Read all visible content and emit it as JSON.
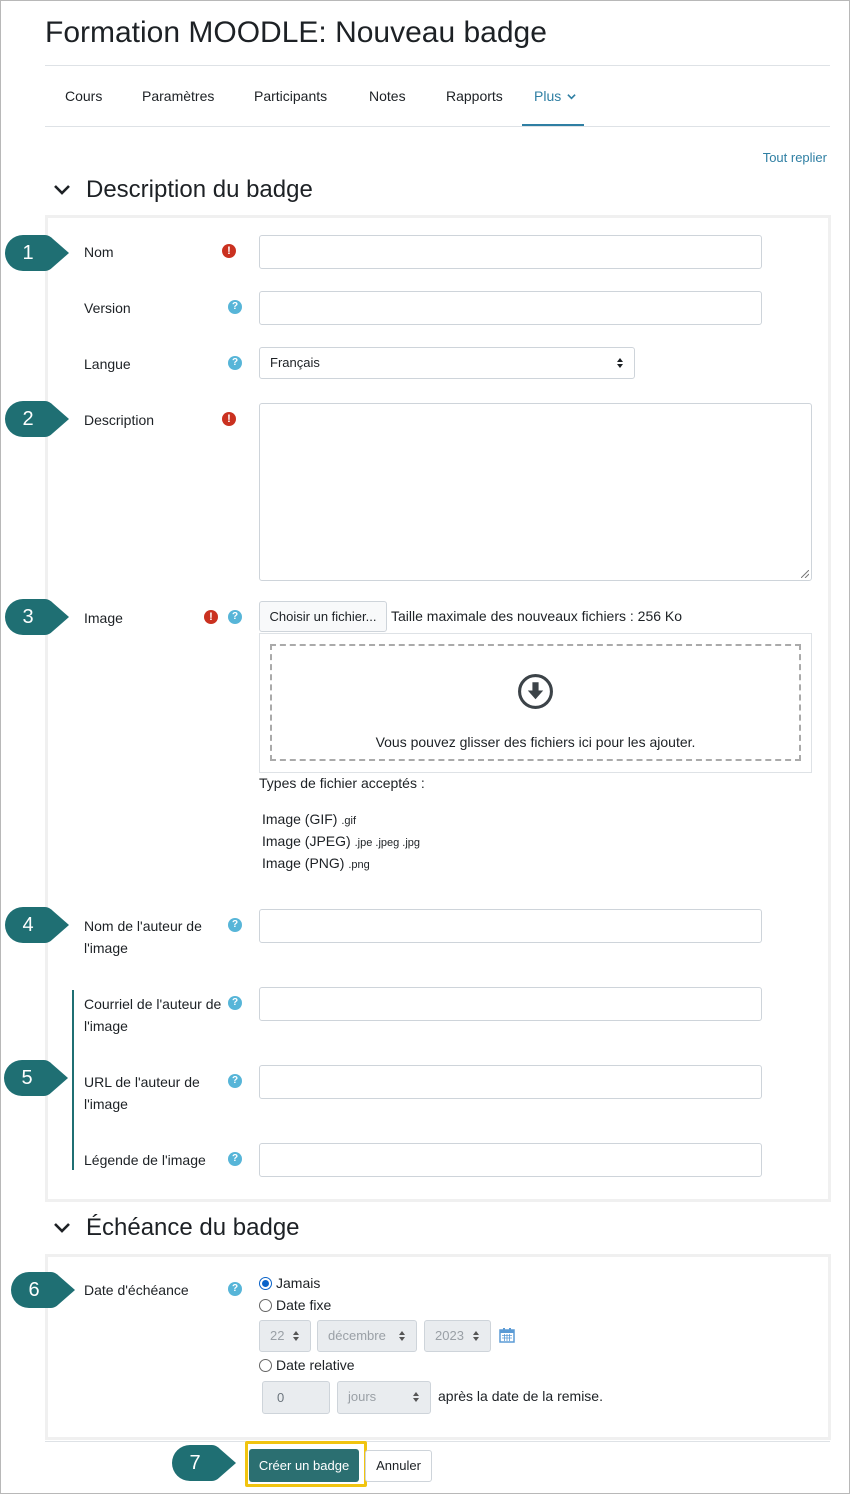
{
  "page_title": "Formation MOODLE: Nouveau badge",
  "nav": {
    "items": [
      "Cours",
      "Paramètres",
      "Participants",
      "Notes",
      "Rapports"
    ],
    "more": "Plus"
  },
  "collapse_all": "Tout replier",
  "section1": {
    "title": "Description du badge",
    "fields": {
      "nom": "Nom",
      "version": "Version",
      "langue": "Langue",
      "langue_value": "Français",
      "description": "Description",
      "image": "Image",
      "author_name_1": "Nom de l'auteur de",
      "author_name_2": "l'image",
      "author_email_1": "Courriel de l'auteur de",
      "author_email_2": "l'image",
      "author_url_1": "URL de l'auteur de",
      "author_url_2": "l'image",
      "caption": "Légende de l'image"
    },
    "file_picker": {
      "button": "Choisir un fichier...",
      "max_size": "Taille maximale des nouveaux fichiers : 256 Ko",
      "drop_text": "Vous pouvez glisser des fichiers ici pour les ajouter.",
      "types_heading": "Types de fichier acceptés :",
      "types": [
        {
          "name": "Image (GIF)",
          "ext": ".gif"
        },
        {
          "name": "Image (JPEG)",
          "ext": ".jpe .jpeg .jpg"
        },
        {
          "name": "Image (PNG)",
          "ext": ".png"
        }
      ]
    }
  },
  "section2": {
    "title": "Échéance du badge",
    "label": "Date d'échéance",
    "options": {
      "never": "Jamais",
      "fixed": "Date fixe",
      "relative": "Date relative"
    },
    "fixed_date": {
      "day": "22",
      "month": "décembre",
      "year": "2023"
    },
    "relative": {
      "value": "0",
      "unit": "jours",
      "suffix": "après la date de la remise."
    }
  },
  "actions": {
    "create": "Créer un badge",
    "cancel": "Annuler"
  },
  "callouts": [
    "1",
    "2",
    "3",
    "4",
    "5",
    "6",
    "7"
  ],
  "colors": {
    "callout": "#1f6f73",
    "primary": "#2b6f71",
    "link": "#2f7fa3",
    "required": "#ca3120",
    "help": "#57b5d8",
    "highlight": "#f1c40f"
  },
  "icons": [
    "chevron-down-icon",
    "required-icon",
    "help-icon",
    "download-icon",
    "calendar-icon",
    "select-arrows-icon"
  ]
}
